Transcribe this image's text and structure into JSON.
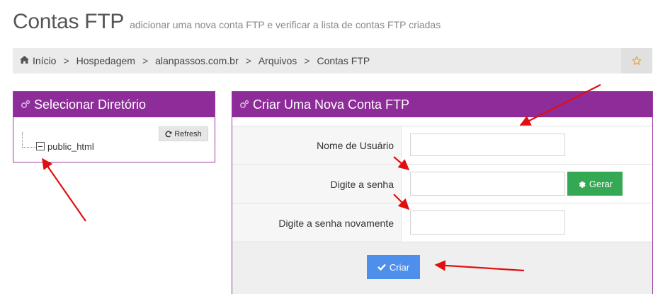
{
  "header": {
    "title": "Contas FTP",
    "subtitle": "adicionar uma nova conta FTP e verificar a lista de contas FTP criadas"
  },
  "breadcrumb": {
    "items": [
      "Início",
      "Hospedagem",
      "alanpassos.com.br",
      "Arquivos",
      "Contas FTP"
    ],
    "separator": ">",
    "favorite_icon": "star-icon"
  },
  "directory_panel": {
    "title": "Selecionar Diretório",
    "refresh_label": "Refresh",
    "tree": [
      {
        "label": "public_html",
        "expanded": true
      }
    ]
  },
  "ftp_form": {
    "title": "Criar Uma Nova Conta FTP",
    "username_label": "Nome de Usuário",
    "username_value": "",
    "password_label": "Digite a senha",
    "password_value": "",
    "generate_label": "Gerar",
    "password_confirm_label": "Digite a senha novamente",
    "password_confirm_value": "",
    "submit_label": "Criar"
  },
  "colors": {
    "panel_header": "#8e2c9a",
    "generate_button": "#34a853",
    "submit_button": "#4d8fea",
    "star_icon": "#f0a030",
    "annotation_arrows": "#e01010"
  }
}
